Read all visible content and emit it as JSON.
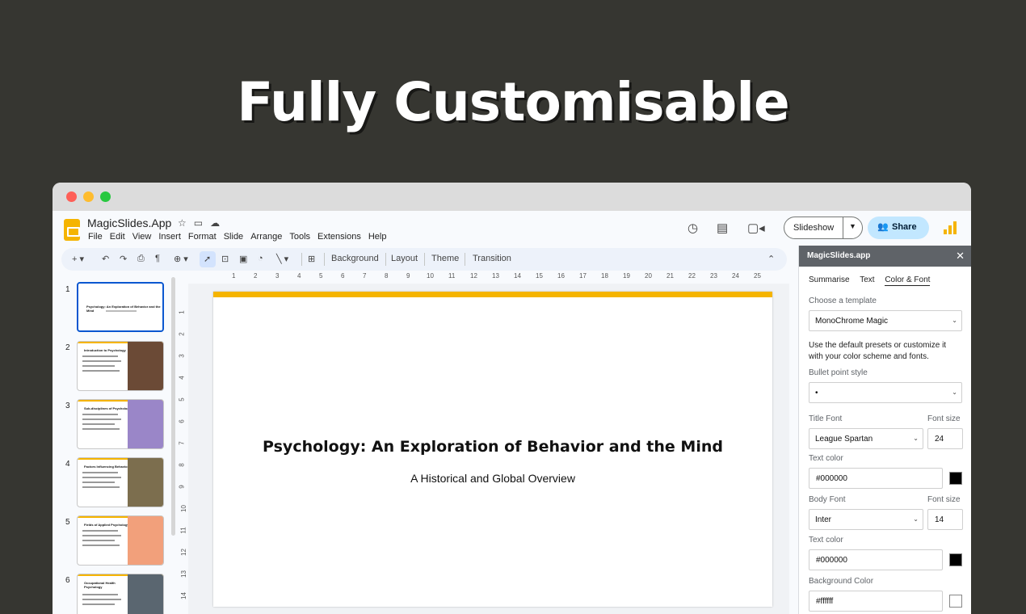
{
  "headline": "Fully Customisable",
  "app": {
    "doc_title": "MagicSlides.App",
    "menu": [
      "File",
      "Edit",
      "View",
      "Insert",
      "Format",
      "Slide",
      "Arrange",
      "Tools",
      "Extensions",
      "Help"
    ],
    "slideshow_label": "Slideshow",
    "share_label": "Share"
  },
  "toolbar": {
    "background_label": "Background",
    "layout_label": "Layout",
    "theme_label": "Theme",
    "transition_label": "Transition"
  },
  "ruler_h": [
    "1",
    "2",
    "3",
    "4",
    "5",
    "6",
    "7",
    "8",
    "9",
    "10",
    "11",
    "12",
    "13",
    "14",
    "15",
    "16",
    "17",
    "18",
    "19",
    "20",
    "21",
    "22",
    "23",
    "24",
    "25"
  ],
  "ruler_v": [
    "1",
    "2",
    "3",
    "4",
    "5",
    "6",
    "7",
    "8",
    "9",
    "10",
    "11",
    "12",
    "13",
    "14"
  ],
  "filmstrip": {
    "numbers": [
      "1",
      "2",
      "3",
      "4",
      "5",
      "6"
    ],
    "slide1_title": "Psychology: An Exploration of Behavior and the Mind",
    "thumb_titles": [
      "Introduction to Psychology",
      "Sub-disciplines of Psychology",
      "Factors Influencing Behavior",
      "Fields of Applied Psychology",
      "Occupational Health Psychology"
    ]
  },
  "slide": {
    "title": "Psychology: An Exploration of Behavior and the Mind",
    "subtitle": "A Historical and Global Overview",
    "accent": "#f5b400"
  },
  "panel": {
    "header": "MagicSlides.app",
    "tabs": [
      "Summarise",
      "Text",
      "Color & Font"
    ],
    "active_tab": "Color & Font",
    "template_label": "Choose a template",
    "template_value": "MonoChrome Magic",
    "help_text_1": "Use the default presets or customize it",
    "help_text_2": "with your color scheme and fonts.",
    "bullet_label": "Bullet point style",
    "bullet_value": "•",
    "title_font_label": "Title Font",
    "title_font_value": "League Spartan",
    "font_size_label": "Font size",
    "title_font_size": "24",
    "text_color_label": "Text color",
    "title_text_color": "#000000",
    "body_font_label": "Body Font",
    "body_font_value": "Inter",
    "body_font_size": "14",
    "body_text_color": "#000000",
    "bg_color_label": "Background Color",
    "bg_color_value": "#ffffff"
  },
  "icons": [
    "star-icon",
    "folder-move-icon",
    "cloud-icon",
    "history-icon",
    "comment-icon",
    "video-icon",
    "share-people-icon",
    "close-icon"
  ]
}
